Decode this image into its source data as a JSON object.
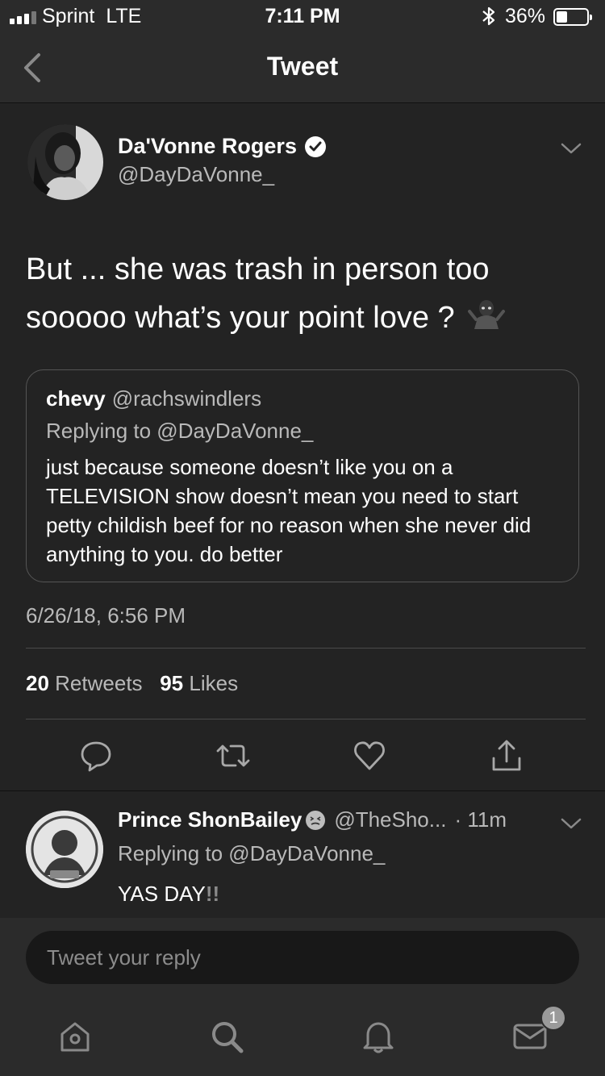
{
  "status_bar": {
    "carrier": "Sprint",
    "network": "LTE",
    "time": "7:11 PM",
    "bluetooth_icon": "bluetooth-icon",
    "battery_percent": "36%",
    "battery_level": 0.36
  },
  "nav": {
    "title": "Tweet",
    "back_icon": "chevron-left-icon"
  },
  "tweet": {
    "author_name": "Da'Vonne Rogers",
    "verified": true,
    "author_handle": "@DayDaVonne_",
    "text": "But ... she was trash in person too sooooo what’s your point love ?",
    "emoji": "person-shrugging-emoji",
    "quoted": {
      "name": "chevy",
      "handle": "@rachswindlers",
      "replying_to": "Replying to @DayDaVonne_",
      "text": "just because someone doesn’t like you on a TELEVISION show doesn’t mean you need to start petty childish beef for no reason when she never did anything to you. do better"
    },
    "timestamp": "6/26/18, 6:56 PM",
    "retweets_count": "20",
    "retweets_label": "Retweets",
    "likes_count": "95",
    "likes_label": "Likes",
    "actions": [
      "reply-icon",
      "retweet-icon",
      "like-icon",
      "share-icon"
    ]
  },
  "reply": {
    "name": "Prince ShonBailey",
    "name_emoji": "nauseated-face-emoji",
    "handle": "@TheSho...",
    "time": "· 11m",
    "replying_to": "Replying to @DayDaVonne_",
    "text": "YAS DAY",
    "text_suffix": "!!"
  },
  "composer": {
    "placeholder": "Tweet your reply"
  },
  "tabbar": {
    "tabs": [
      "home-icon",
      "search-icon",
      "notifications-icon",
      "messages-icon"
    ],
    "messages_badge": "1"
  }
}
